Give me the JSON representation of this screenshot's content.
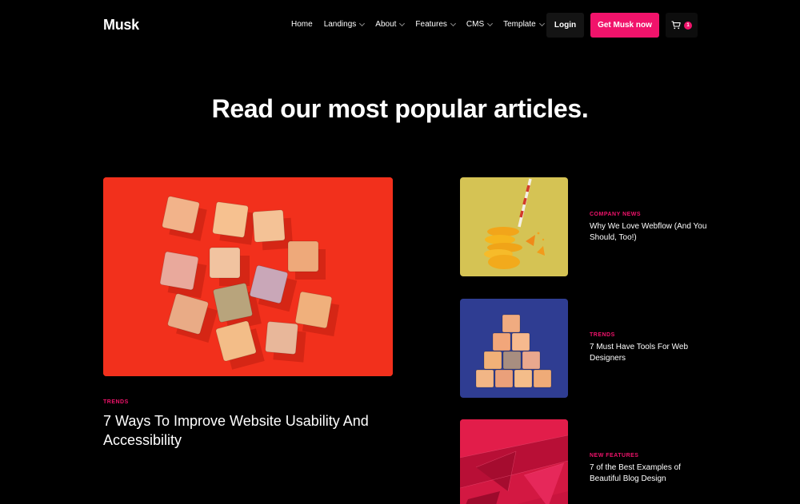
{
  "nav": {
    "logo": "Musk",
    "items": [
      {
        "label": "Home",
        "has_dropdown": false
      },
      {
        "label": "Landings",
        "has_dropdown": true
      },
      {
        "label": "About",
        "has_dropdown": true
      },
      {
        "label": "Features",
        "has_dropdown": true
      },
      {
        "label": "CMS",
        "has_dropdown": true
      },
      {
        "label": "Template",
        "has_dropdown": true
      }
    ],
    "login_label": "Login",
    "cta_label": "Get Musk now",
    "cart_count": "1"
  },
  "heading": "Read our most popular articles.",
  "featured": {
    "category": "TRENDS",
    "title": "7 Ways To Improve Website Usability And Accessibility",
    "image_icon": "wooden-blocks-image"
  },
  "articles": [
    {
      "category": "COMPANY NEWS",
      "title": "Why We Love Webflow (And You Should, Too!)",
      "image_icon": "orange-slices-image"
    },
    {
      "category": "TRENDS",
      "title": "7 Must Have Tools For Web Designers",
      "image_icon": "block-pyramid-image"
    },
    {
      "category": "NEW FEATURES",
      "title": "7 of the Best Examples of Beautiful Blog Design",
      "image_icon": "red-facets-image"
    }
  ],
  "colors": {
    "accent": "#f1136b",
    "background": "#000000"
  }
}
